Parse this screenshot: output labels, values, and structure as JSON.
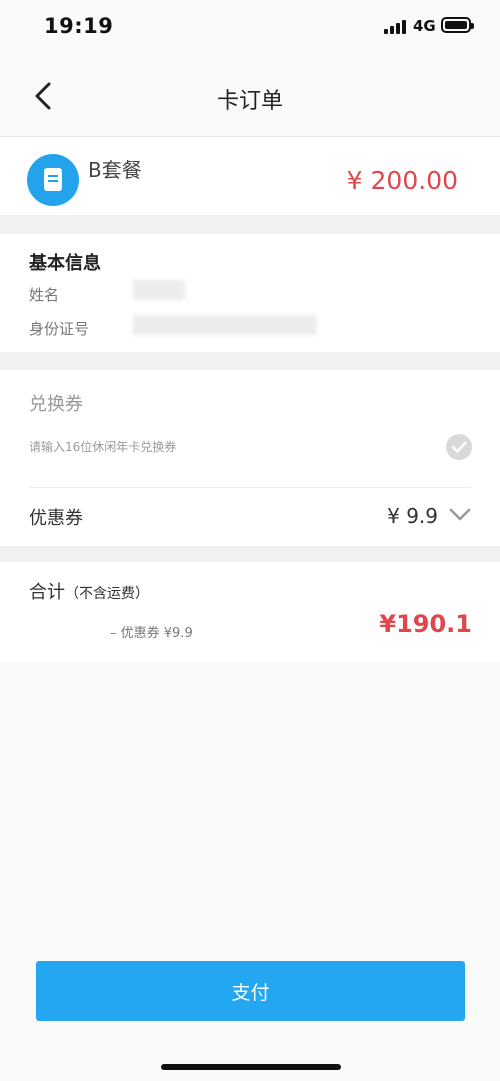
{
  "status_bar": {
    "time": "19:19",
    "network": "4G"
  },
  "nav": {
    "title": "卡订单"
  },
  "product": {
    "name": "B套餐",
    "price": "¥ 200.00"
  },
  "basic_info": {
    "title": "基本信息",
    "name_label": "姓名",
    "id_label": "身份证号"
  },
  "voucher": {
    "title": "兑换券",
    "placeholder": "请输入16位休闲年卡兑换券"
  },
  "coupon": {
    "label": "优惠券",
    "value": "¥ 9.9"
  },
  "total": {
    "label": "合计",
    "note": "（不含运费）",
    "discount": "– 优惠券 ¥9.9",
    "amount": "¥190.1"
  },
  "pay_button": {
    "label": "支付"
  },
  "colors": {
    "accent": "#23a7f0",
    "price_red": "#e0474c",
    "background": "#fafafa"
  }
}
